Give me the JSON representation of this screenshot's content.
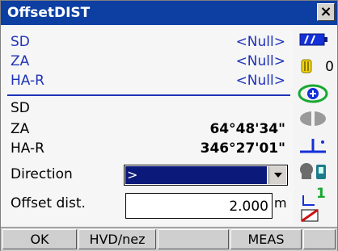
{
  "window": {
    "title": "OffsetDIST",
    "close_label": "×"
  },
  "measured": [
    {
      "label": "SD",
      "value": "<Null>"
    },
    {
      "label": "ZA",
      "value": "<Null>"
    },
    {
      "label": "HA-R",
      "value": "<Null>"
    }
  ],
  "target": [
    {
      "label": "SD",
      "value": ""
    },
    {
      "label": "ZA",
      "value": "64°48'34\""
    },
    {
      "label": "HA-R",
      "value": "346°27'01\""
    }
  ],
  "direction": {
    "label": "Direction",
    "value": ">"
  },
  "offset": {
    "label": "Offset dist.",
    "value": "2.000",
    "unit": "m"
  },
  "status": {
    "battery_level": "full",
    "prism_constant": "0",
    "laser": "on",
    "tilt": "on",
    "bluetooth": "on",
    "input_mode": "1"
  },
  "softkeys": [
    "OK",
    "HVD/nez",
    "",
    "MEAS",
    ""
  ]
}
